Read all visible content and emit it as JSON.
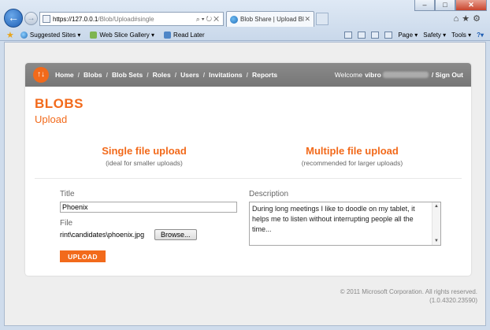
{
  "browser": {
    "address_host": "https://127.0.0.1",
    "address_path": "/Blob/Upload#single",
    "tab_title": "Blob Share | Upload Blob",
    "favorites": [
      {
        "label": "Suggested Sites ▾"
      },
      {
        "label": "Web Slice Gallery ▾"
      },
      {
        "label": "Read Later"
      }
    ],
    "commands": [
      {
        "label": "Page ▾"
      },
      {
        "label": "Safety ▾"
      },
      {
        "label": "Tools ▾"
      }
    ]
  },
  "nav": {
    "logo": "↑↓",
    "links": [
      "Home",
      "Blobs",
      "Blob Sets",
      "Roles",
      "Users",
      "Invitations",
      "Reports"
    ],
    "welcome": "Welcome",
    "user_prefix": "vibro",
    "signout": "/ Sign Out"
  },
  "page": {
    "heading": "BLOBS",
    "subheading": "Upload"
  },
  "options": {
    "single_title": "Single file upload",
    "single_sub": "(ideal for smaller uploads)",
    "multi_title": "Multiple file upload",
    "multi_sub": "(recommended for larger uploads)"
  },
  "form": {
    "title_label": "Title",
    "title_value": "Phoenix",
    "file_label": "File",
    "file_path": "rint\\candidates\\phoenix.jpg",
    "browse_label": "Browse...",
    "description_label": "Description",
    "description_value": "During long meetings I like to doodle on my tablet, it helps me to listen without interrupting people all the time...",
    "upload_label": "UPLOAD"
  },
  "footer": {
    "copyright": "© 2011 Microsoft Corporation. All rights reserved.",
    "version": "(1.0.4320.23590)"
  },
  "colors": {
    "accent": "#f26a1b",
    "nav_bg": "#7f7f7f"
  }
}
